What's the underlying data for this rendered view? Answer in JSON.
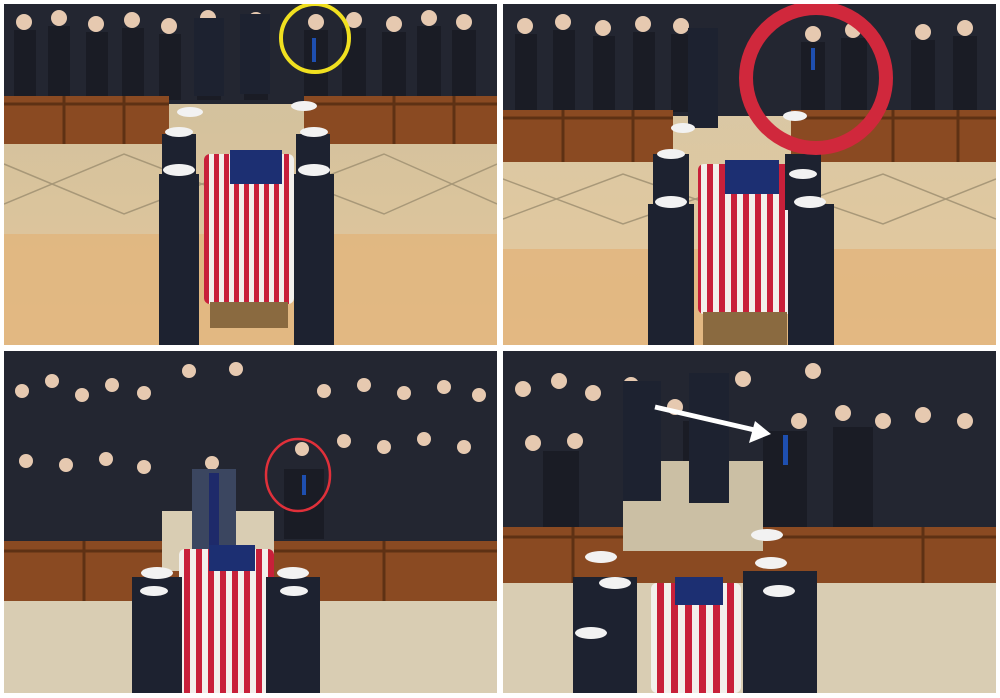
{
  "collage": {
    "layout": "2x2 grid",
    "panels": [
      {
        "annotation": {
          "type": "circle",
          "color": "#f0e020"
        }
      },
      {
        "annotation": {
          "type": "circle",
          "color": "#d0283c"
        }
      },
      {
        "annotation": {
          "type": "circle",
          "color": "#e0303a"
        }
      },
      {
        "annotation": {
          "type": "arrow",
          "color": "#ffffff"
        }
      }
    ]
  },
  "colors": {
    "flag_red": "#c8203a",
    "flag_white": "#f2f0ec",
    "flag_blue": "#1c2f72",
    "pew_wood": "#8a4a22",
    "floor": "#d9cdb3",
    "uniform": "#1d2230",
    "crowd": "#232631"
  },
  "icons": [
    "circle-marker-icon",
    "arrow-marker-icon"
  ]
}
